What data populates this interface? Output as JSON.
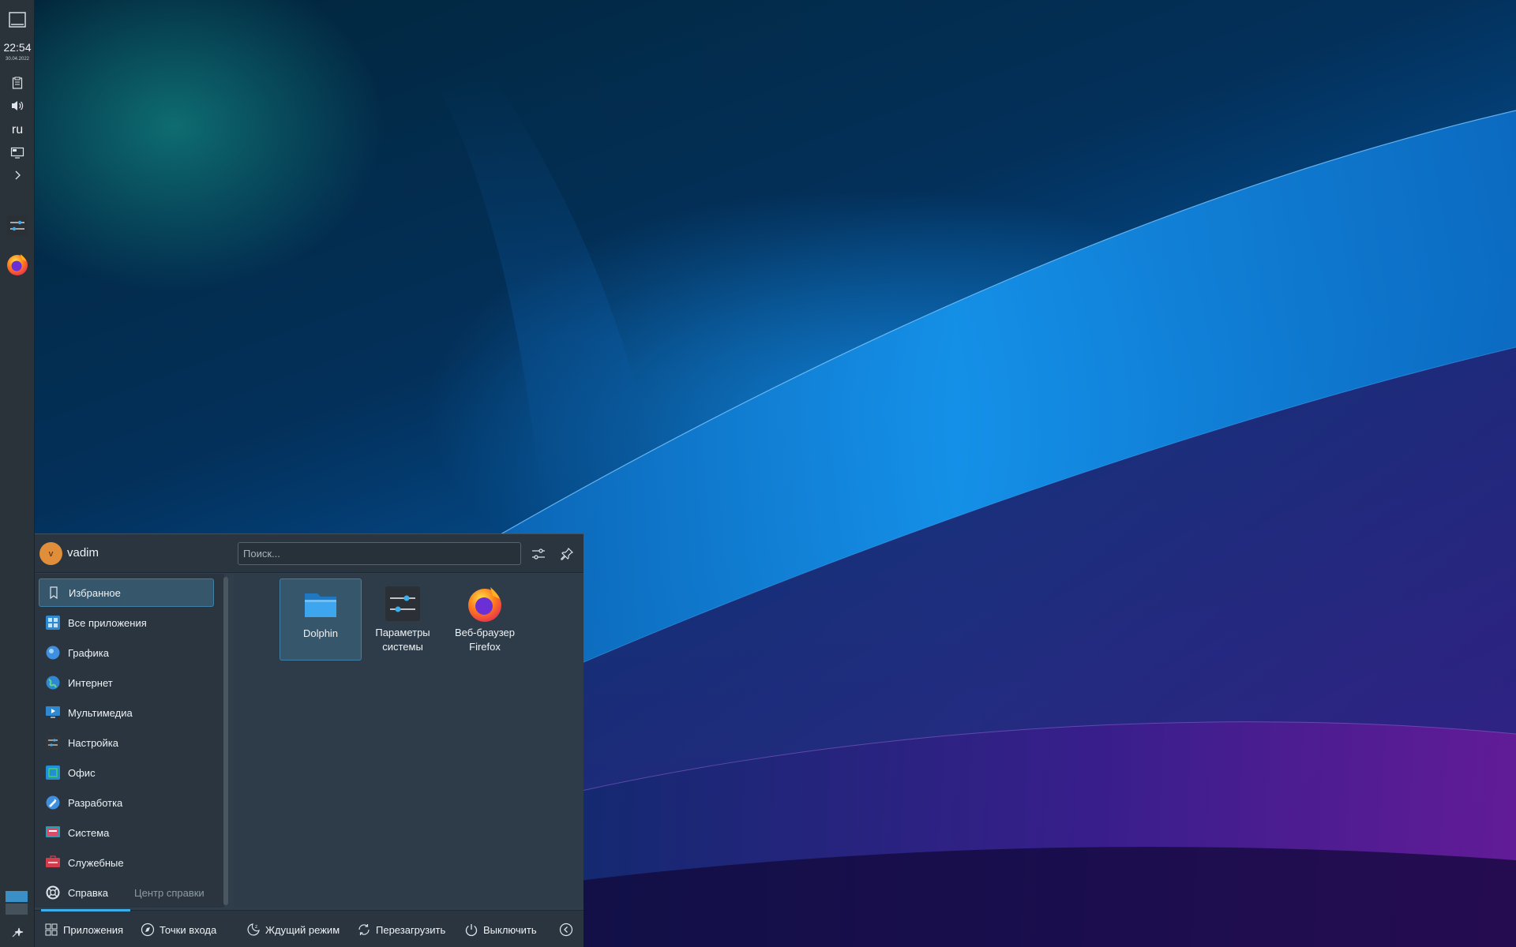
{
  "panel": {
    "time": "22:54",
    "date": "30.04.2022",
    "keyboard_layout": "ru",
    "icons": [
      "show-desktop-icon",
      "clipboard-icon",
      "volume-icon",
      "display-icon",
      "expand-tray-icon",
      "system-settings-icon",
      "firefox-icon",
      "pager-icon",
      "launcher-icon"
    ]
  },
  "launcher": {
    "username": "vadim",
    "avatar_letter": "v",
    "search_placeholder": "Поиск...",
    "categories": [
      {
        "label": "Избранное",
        "icon": "bookmark-icon",
        "active": true
      },
      {
        "label": "Все приложения",
        "icon": "all-apps-icon"
      },
      {
        "label": "Графика",
        "icon": "graphics-icon"
      },
      {
        "label": "Интернет",
        "icon": "internet-icon"
      },
      {
        "label": "Мультимедиа",
        "icon": "multimedia-icon"
      },
      {
        "label": "Настройка",
        "icon": "settings-icon"
      },
      {
        "label": "Офис",
        "icon": "office-icon"
      },
      {
        "label": "Разработка",
        "icon": "development-icon"
      },
      {
        "label": "Система",
        "icon": "system-icon"
      },
      {
        "label": "Служебные",
        "icon": "utilities-icon"
      },
      {
        "label": "Справка",
        "icon": "help-icon",
        "extra": "Центр справки"
      }
    ],
    "apps": [
      {
        "label": "Dolphin",
        "icon": "dolphin-folder-icon",
        "selected": true
      },
      {
        "label": "Параметры системы",
        "icon": "system-settings-icon"
      },
      {
        "label": "Веб-браузер Firefox",
        "icon": "firefox-icon"
      }
    ],
    "footer": {
      "applications": "Приложения",
      "places": "Точки входа",
      "sleep": "Ждущий режим",
      "restart": "Перезагрузить",
      "shutdown": "Выключить"
    }
  },
  "colors": {
    "accent": "#3daee9",
    "panel_bg": "#2a323a",
    "launcher_bg": "#2f3e4a",
    "selection_bg": "#36566c"
  }
}
